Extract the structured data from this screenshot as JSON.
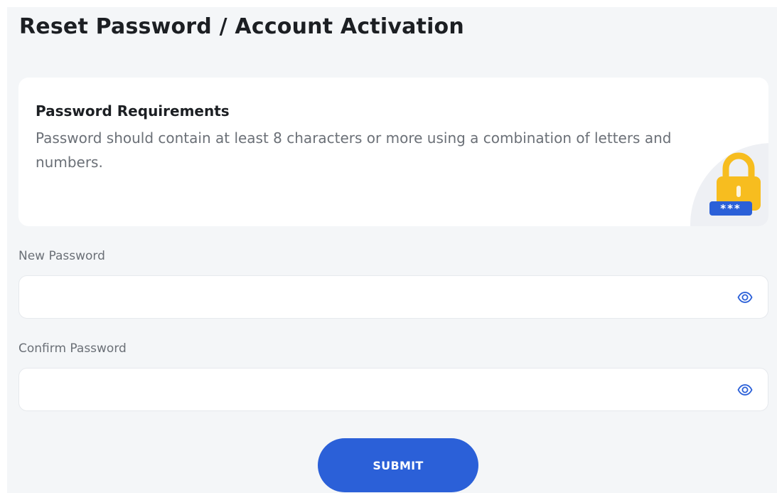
{
  "page": {
    "title": "Reset Password / Account Activation"
  },
  "requirements": {
    "title": "Password Requirements",
    "description": "Password should contain at least 8 characters or more using a combination of letters and numbers.",
    "icon": "lock-icon",
    "badge_text": "***"
  },
  "form": {
    "new_password": {
      "label": "New Password",
      "value": "",
      "placeholder": "",
      "toggle_icon": "eye-icon"
    },
    "confirm_password": {
      "label": "Confirm Password",
      "value": "",
      "placeholder": "",
      "toggle_icon": "eye-icon"
    },
    "submit_label": "SUBMIT"
  },
  "colors": {
    "primary": "#2b60d8",
    "background": "#f4f6f8",
    "lock": "#f7bd1f",
    "text_dark": "#1c1f23",
    "text_muted": "#6b7077"
  }
}
